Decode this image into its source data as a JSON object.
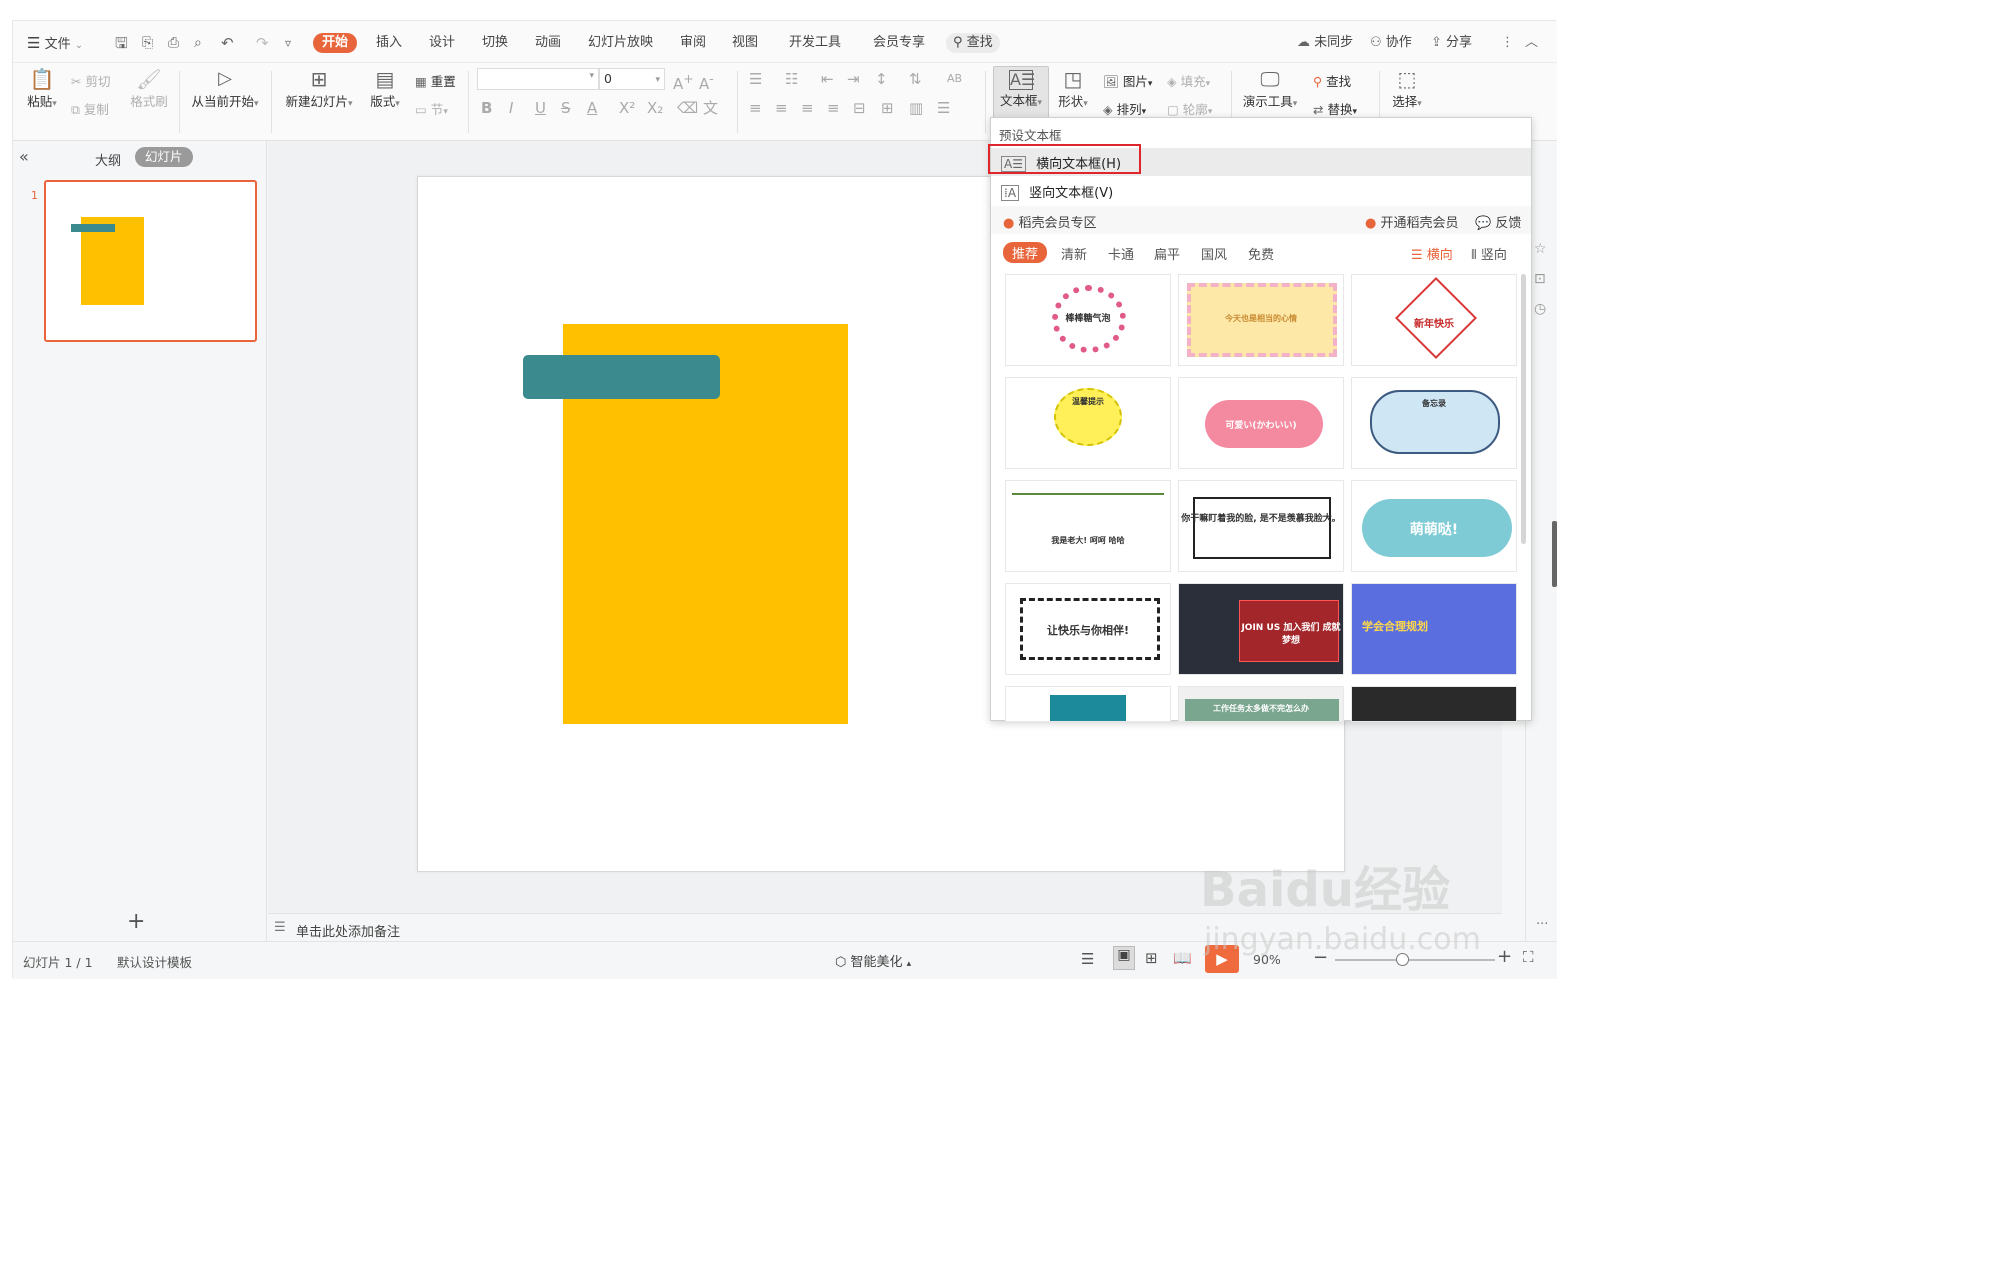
{
  "colors": {
    "accent": "#e8643a",
    "slide_yellow": "#ffc000",
    "slide_teal": "#3a8a8e",
    "highlight_red": "#e0262b"
  },
  "menu": {
    "file": "文件",
    "tabs": [
      {
        "label": "开始",
        "active": true
      },
      {
        "label": "插入"
      },
      {
        "label": "设计"
      },
      {
        "label": "切换"
      },
      {
        "label": "动画"
      },
      {
        "label": "幻灯片放映"
      },
      {
        "label": "审阅"
      },
      {
        "label": "视图"
      },
      {
        "label": "开发工具"
      },
      {
        "label": "会员专享"
      }
    ],
    "search": "查找",
    "sync": "未同步",
    "collab": "协作",
    "share": "分享"
  },
  "ribbon": {
    "paste": "粘贴",
    "cut": "剪切",
    "copy": "复制",
    "format_painter": "格式刷",
    "from_current": "从当前开始",
    "new_slide": "新建幻灯片",
    "layout": "版式",
    "reset": "重置",
    "section": "节",
    "font_size": "0",
    "textbox": "文本框",
    "shape": "形状",
    "picture": "图片",
    "fill": "填充",
    "arrange": "排列",
    "outline": "轮廓",
    "presenter_tools": "演示工具",
    "find": "查找",
    "replace": "替换",
    "select": "选择"
  },
  "sidepanel": {
    "outline_tab": "大纲",
    "slides_tab": "幻灯片",
    "slide_number": "1",
    "add": "+"
  },
  "notes": {
    "placeholder": "单击此处添加备注"
  },
  "status": {
    "slide_info": "幻灯片 1 / 1",
    "template": "默认设计模板",
    "smart_beautify": "智能美化",
    "zoom": "90%"
  },
  "dropdown": {
    "section_title": "预设文本框",
    "horizontal": "横向文本框(H)",
    "vertical": "竖向文本框(V)",
    "member_zone": "稻壳会员专区",
    "open_member": "开通稻壳会员",
    "feedback": "反馈",
    "filters": [
      "推荐",
      "清新",
      "卡通",
      "扁平",
      "国风",
      "免费"
    ],
    "orient_h": "横向",
    "orient_v": "竖向",
    "thumbnails": [
      {
        "text": "棒棒糖气泡"
      },
      {
        "text": "今天也是相当的心情"
      },
      {
        "text": "新年快乐"
      },
      {
        "text": "温馨提示"
      },
      {
        "text": "可爱い(かわいい)"
      },
      {
        "text": "备忘录"
      },
      {
        "text": "我是老大!  呵呵  哈哈"
      },
      {
        "text": "你干嘛盯着我的脸, 是不是羡慕我脸大。"
      },
      {
        "text": "萌萌哒!"
      },
      {
        "text": "让快乐与你相伴!"
      },
      {
        "text": "JOIN US 加入我们 成就梦想"
      },
      {
        "text": "学会合理规划"
      },
      {
        "text": ""
      },
      {
        "text": "工作任务太多做不完怎么办"
      },
      {
        "text": ""
      }
    ]
  },
  "watermark": {
    "brand": "Baidu经验",
    "url": "jingyan.baidu.com"
  }
}
